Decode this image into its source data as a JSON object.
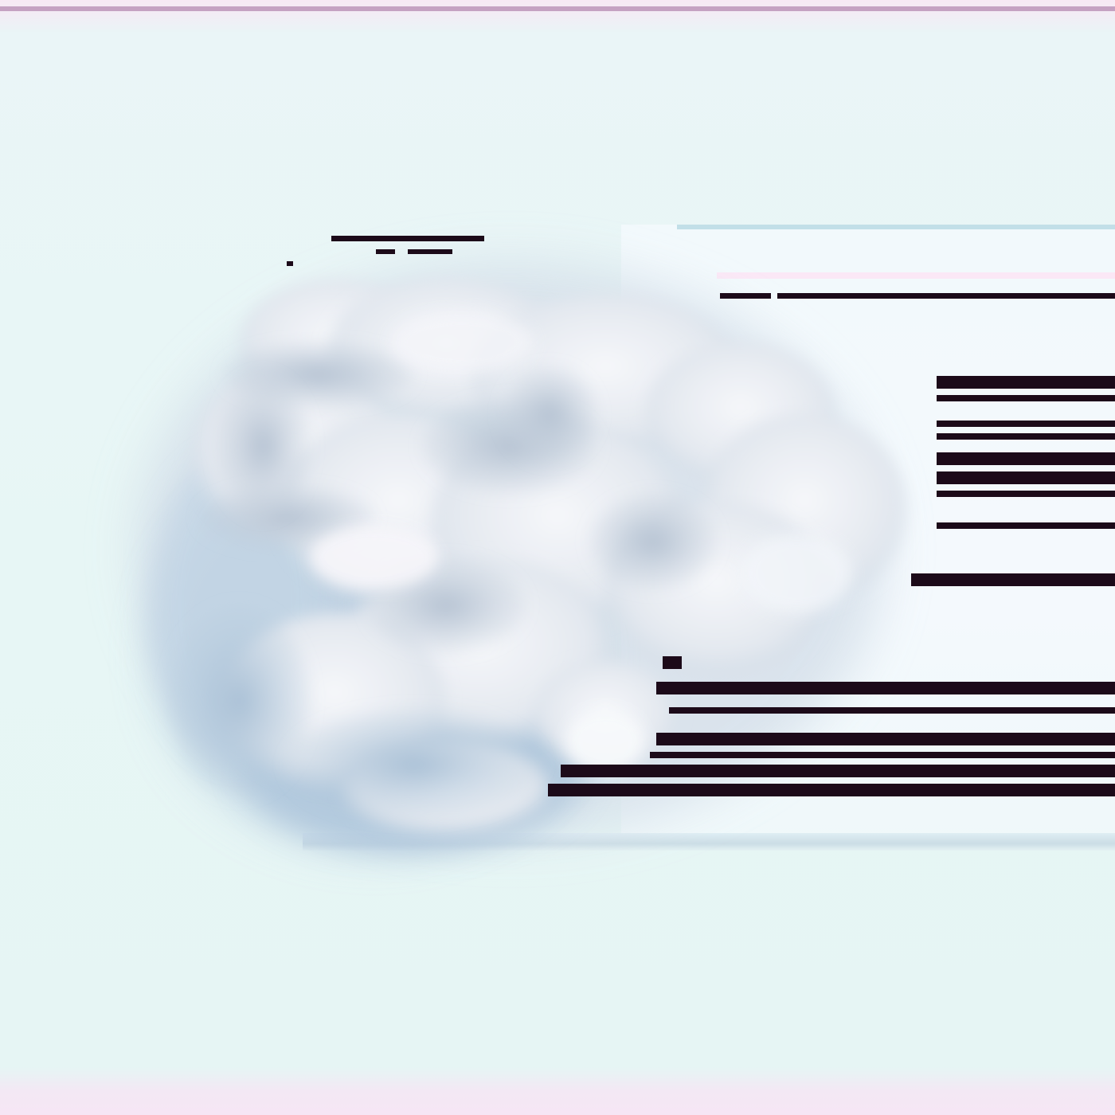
{
  "image": {
    "subject": "cloud-of-smoke",
    "colors": {
      "background": "#e8f6f6",
      "cloud_light": "#f2f4f8",
      "cloud_mid": "#c9d3df",
      "cloud_shadow": "#9fb5cb",
      "band_pink": "#f6e6f5",
      "glitch_bar": "#1c0a19"
    }
  }
}
